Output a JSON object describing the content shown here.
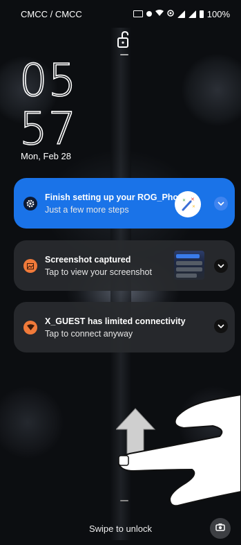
{
  "status_bar": {
    "carrier": "CMCC / CMCC",
    "battery": "100%"
  },
  "lockscreen": {
    "clock_hour": "05",
    "clock_minute": "57",
    "date": "Mon, Feb 28"
  },
  "notifications": [
    {
      "title": "Finish setting up your ROG_Pho..",
      "subtitle": "Just a few more steps",
      "icon": "gear-icon",
      "accent": "#1a73e8"
    },
    {
      "title": "Screenshot captured",
      "subtitle": "Tap to view your screenshot",
      "icon": "image-icon",
      "accent": "#f07a3a"
    },
    {
      "title": "X_GUEST has limited connectivity",
      "subtitle": "Tap to connect anyway",
      "icon": "wifi-alert-icon",
      "accent": "#f07a3a"
    }
  ],
  "bottom": {
    "swipe_hint": "Swipe to unlock",
    "camera_icon": "camera-icon"
  }
}
